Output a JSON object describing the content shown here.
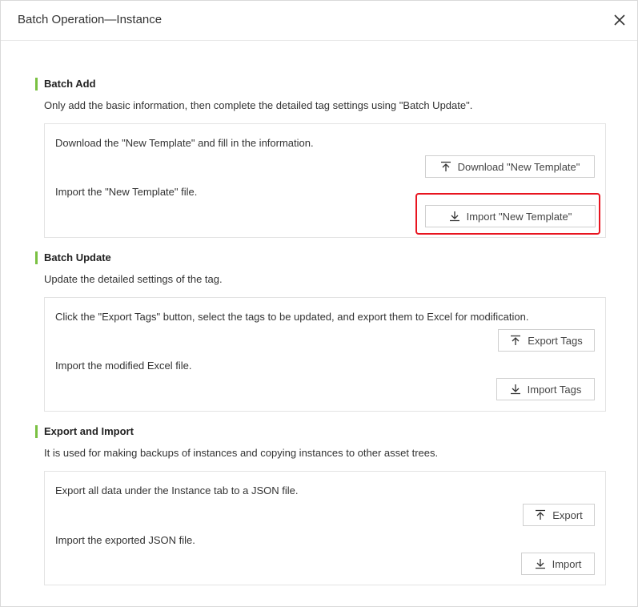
{
  "dialog": {
    "title": "Batch Operation—Instance",
    "close_icon": "close-icon"
  },
  "batch_add": {
    "title": "Batch Add",
    "description": "Only add the basic information, then complete the detailed tag settings using \"Batch Update\".",
    "download_text": "Download the \"New Template\" and fill in the information.",
    "download_button": "Download \"New Template\"",
    "import_text": "Import the \"New Template\" file.",
    "import_button": "Import \"New Template\""
  },
  "batch_update": {
    "title": "Batch Update",
    "description": "Update the detailed settings of the tag.",
    "export_text": "Click the \"Export Tags\" button, select the tags to be updated, and export them to Excel for modification.",
    "export_button": "Export Tags",
    "import_text": "Import the modified Excel file.",
    "import_button": "Import Tags"
  },
  "export_import": {
    "title": "Export and Import",
    "description": "It is used for making backups of instances and copying instances to other asset trees.",
    "export_text": "Export all data under the Instance tab to a JSON file.",
    "export_button": "Export",
    "import_text": "Import the exported JSON file.",
    "import_button": "Import"
  },
  "colors": {
    "accent": "#7ac142",
    "highlight": "#e8141f",
    "border": "#e3e3e3"
  },
  "icons": {
    "upload": "upload-icon",
    "download": "download-icon"
  }
}
